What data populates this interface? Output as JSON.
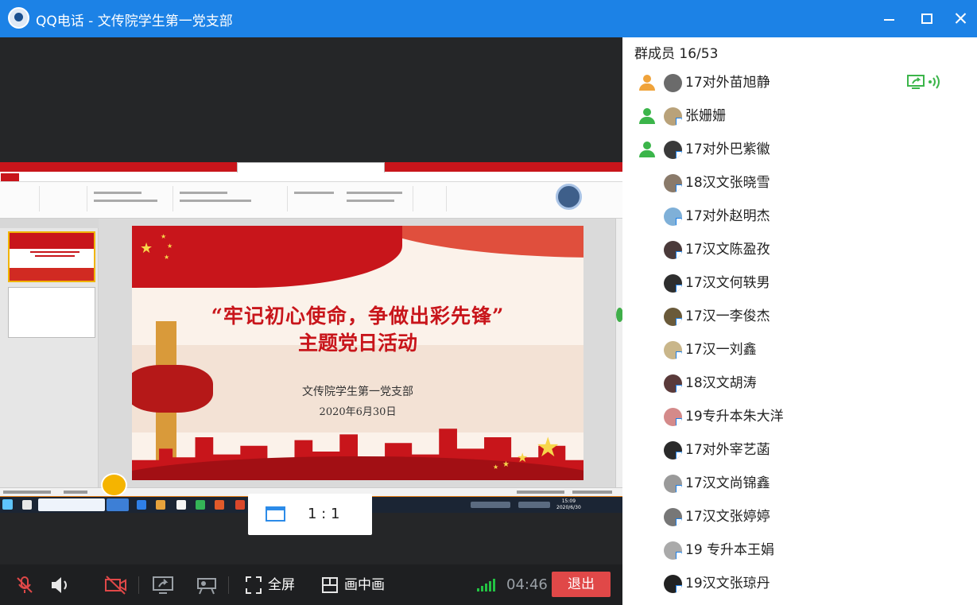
{
  "window": {
    "title": "QQ电话 - 文传院学生第一党支部"
  },
  "shared_screen": {
    "slide": {
      "title_line1": "“牢记初心使命，争做出彩先锋”",
      "title_line2": "主题党日活动",
      "org": "文传院学生第一党支部",
      "date": "2020年6月30日"
    },
    "taskbar_clock": {
      "time": "15:09",
      "date": "2020/6/30"
    }
  },
  "view": {
    "ratio_label": "1 : 1"
  },
  "controls": {
    "fullscreen_label": "全屏",
    "pip_label": "画中画",
    "timer": "04:46",
    "exit_label": "退出",
    "colors": {
      "exit": "#e04848",
      "signal": "#23c343",
      "accent": "#1c82e6"
    }
  },
  "members": {
    "header": "群成员 16/53",
    "list": [
      {
        "name": "17对外苗旭静",
        "role_icon": "person-orange-icon",
        "sharing": true
      },
      {
        "name": "张姗姗",
        "role_icon": "person-green-icon",
        "sharing": false
      },
      {
        "name": "17对外巴紫徽",
        "role_icon": "person-green-icon",
        "sharing": false
      },
      {
        "name": "18汉文张晓雪"
      },
      {
        "name": "17对外赵明杰"
      },
      {
        "name": "17汉文陈盈孜"
      },
      {
        "name": "17汉文何轶男"
      },
      {
        "name": "17汉一李俊杰"
      },
      {
        "name": "17汉一刘鑫"
      },
      {
        "name": "18汉文胡涛"
      },
      {
        "name": "19专升本朱大洋"
      },
      {
        "name": "17对外宰艺菡"
      },
      {
        "name": "17汉文尚锦鑫"
      },
      {
        "name": "17汉文张婷婷"
      },
      {
        "name": "19 专升本王娟"
      },
      {
        "name": "19汉文张琼丹"
      }
    ]
  }
}
